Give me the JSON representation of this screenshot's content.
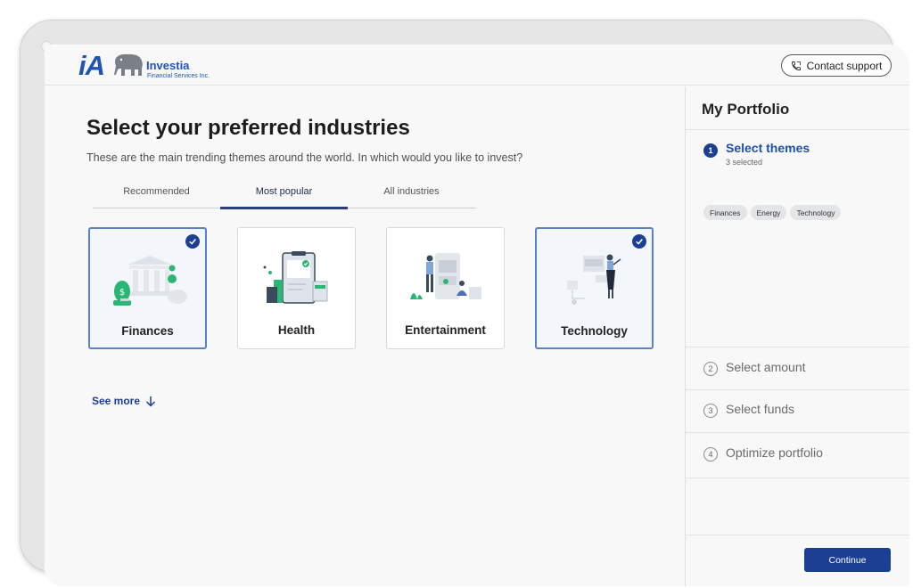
{
  "brand": {
    "logo_mark": "iA",
    "name": "Investia",
    "subtitle": "Financial Services Inc."
  },
  "header": {
    "support_label": "Contact support",
    "support_icon": "phone-icon"
  },
  "main": {
    "title": "Select your preferred industries",
    "description": "These are the main trending themes around the world. In which would you like to invest?",
    "tabs": [
      {
        "label": "Recommended",
        "active": false
      },
      {
        "label": "Most popular",
        "active": true
      },
      {
        "label": "All industries",
        "active": false
      }
    ],
    "cards": [
      {
        "label": "Finances",
        "selected": true,
        "icon": "finance-illustration"
      },
      {
        "label": "Health",
        "selected": false,
        "icon": "health-illustration"
      },
      {
        "label": "Entertainment",
        "selected": false,
        "icon": "entertainment-illustration"
      },
      {
        "label": "Technology",
        "selected": true,
        "icon": "technology-illustration"
      }
    ],
    "see_more": "See more"
  },
  "portfolio": {
    "title": "My Portfolio",
    "steps": [
      {
        "number": "1",
        "label": "Select themes",
        "sub": "3 selected",
        "active": true
      },
      {
        "number": "2",
        "label": "Select amount",
        "active": false
      },
      {
        "number": "3",
        "label": "Select funds",
        "active": false
      },
      {
        "number": "4",
        "label": "Optimize portfolio",
        "active": false
      }
    ],
    "chips": [
      "Finances",
      "Energy",
      "Technology"
    ],
    "continue_label": "Continue"
  },
  "colors": {
    "primary": "#1d3f93",
    "accent_blue": "#1e54b7",
    "selected_border": "#5a80c9",
    "green": "#2bb673"
  }
}
